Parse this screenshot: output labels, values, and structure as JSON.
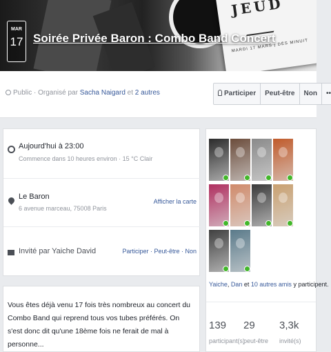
{
  "event": {
    "month": "MAR",
    "day": "17",
    "title": "Soirée Privée Baron : Combo Band Concert",
    "poster_title": "JEUD",
    "poster_date": "MARDI 17 MARS | DÈS MINUIT"
  },
  "header": {
    "privacy": "Public",
    "organized_by": " · Organisé par ",
    "organizer_name": "Sacha Naigard",
    "and": " et ",
    "others": "2 autres",
    "rsvp": [
      "Participer",
      "Peut-être",
      "Non",
      "•••"
    ]
  },
  "details": {
    "time_main": "Aujourd'hui à 23:00",
    "time_sub": "Commence dans 10 heures environ · 15 °C Clair",
    "place_name": "Le Baron",
    "place_address": "6 avenue marceau, 75008 Paris",
    "place_action": "Afficher la carte",
    "invite_text": "Invité par Yaiche David",
    "invite_actions": "Participer · Peut-être · Non"
  },
  "description": "Vous êtes déjà venu 17 fois très nombreux au concert du Combo Band qui reprend tous vos tubes préférés. On s'est donc dit qu'une 18ème fois ne ferait de mal à personne...",
  "friends": {
    "going_name1": "Yaiche",
    "going_sep": ", ",
    "going_name2": "Dan",
    "going_and": " et ",
    "going_others": "10 autres amis",
    "going_suffix": " y participent.",
    "avatar_colors": [
      "#2b2b2b",
      "#6b4c3b",
      "#8a8a8a",
      "#c05a2a",
      "#b03060",
      "#d08a6a",
      "#3a3a3a",
      "#c9a070",
      "#404040",
      "#5a7a8a"
    ],
    "stats": [
      {
        "value": "139",
        "label": "participant(s)"
      },
      {
        "value": "29",
        "label": "peut-être"
      },
      {
        "value": "3,3k",
        "label": "invité(s)"
      }
    ]
  }
}
